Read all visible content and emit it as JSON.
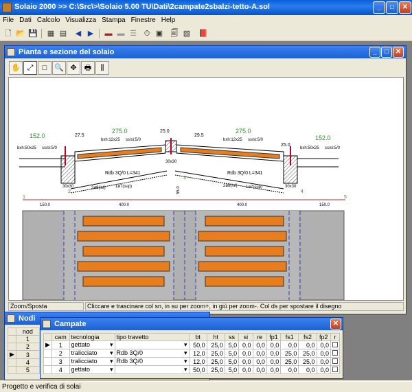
{
  "app": {
    "title": "Solaio 2000  >> C:\\Src\\>\\Solaio 5.00 TU\\Dati\\2campate2sbalzi-tetto-A.sol",
    "min": "_",
    "max": "□",
    "close": "✕"
  },
  "menu": [
    "File",
    "Dati",
    "Calcolo",
    "Visualizza",
    "Stampa",
    "Finestre",
    "Help"
  ],
  "pianta": {
    "title": "Pianta e sezione del solaio",
    "tools": [
      "✋",
      "⤢",
      "□",
      "🔍",
      "✥",
      "🖶",
      "⫼"
    ],
    "status_left": "Zoom/Sposta",
    "status_right": "Cliccare e trascinare col sn, in su per zoom+, in giù per zoom-. Col ds per spostare il disegno",
    "labels": {
      "d1": "152.0",
      "d1b": "bxh:50x25",
      "d1c": "ss/si:5/0",
      "d2": "27.5",
      "d3": "275.0",
      "d3b": "bxh:12x25",
      "d3c": "ss/si:5/0",
      "d4": "25.0",
      "d5": "29.5",
      "d6": "275.0",
      "d6b": "bxh:12x25",
      "d6c": "ss/si:5/0",
      "d7": "25.0",
      "d8": "152.0",
      "d8b": "bxh:50x25",
      "d8c": "ss/si:5/0",
      "p1": "30x30",
      "p2": "30x30",
      "p3": "30x30",
      "p4": "30x30",
      "rdb1": "Rdb 3Q/0 L=341",
      "rdb1b": "2ø8(inf)",
      "rdb1c": "1ø7(sup)",
      "rdb2": "Rdb 3Q/0 L=341",
      "rdb2b": "2ø8(inf)",
      "rdb2c": "1ø7(sup)",
      "h": "55.0",
      "n1": "1",
      "n2": "2",
      "n3": "3",
      "n4": "4",
      "n5": "5",
      "s1": "150.0",
      "s2": "400.0",
      "s3": "400.0",
      "s4": "150.0"
    }
  },
  "nodi": {
    "title": "Nodi",
    "header": "nod",
    "rows": [
      "1",
      "2",
      "3",
      "4",
      "5"
    ]
  },
  "campate": {
    "title": "Campate",
    "headers": [
      "cam",
      "tecnologia",
      "tipo travetto",
      "bt",
      "ht",
      "ss",
      "si",
      "re",
      "fp1",
      "fs1",
      "fs2",
      "fp2",
      "r"
    ],
    "rows": [
      [
        "1",
        "gettato",
        "",
        "50,0",
        "25,0",
        "5,0",
        "0,0",
        "0,0",
        "0,0",
        "0,0",
        "0,0",
        "0,0"
      ],
      [
        "2",
        "tralicciato",
        "Rdb 3Q/0",
        "12,0",
        "25,0",
        "5,0",
        "0,0",
        "0,0",
        "0,0",
        "25,0",
        "25,0",
        "0,0"
      ],
      [
        "3",
        "tralicciato",
        "Rdb 3Q/0",
        "12,0",
        "25,0",
        "5,0",
        "0,0",
        "0,0",
        "0,0",
        "25,0",
        "25,0",
        "0,0"
      ],
      [
        "4",
        "gettato",
        "",
        "50,0",
        "25,0",
        "5,0",
        "0,0",
        "0,0",
        "0,0",
        "0,0",
        "0,0",
        "0,0"
      ]
    ]
  },
  "statusbar": "Progetto e verifica di solai"
}
